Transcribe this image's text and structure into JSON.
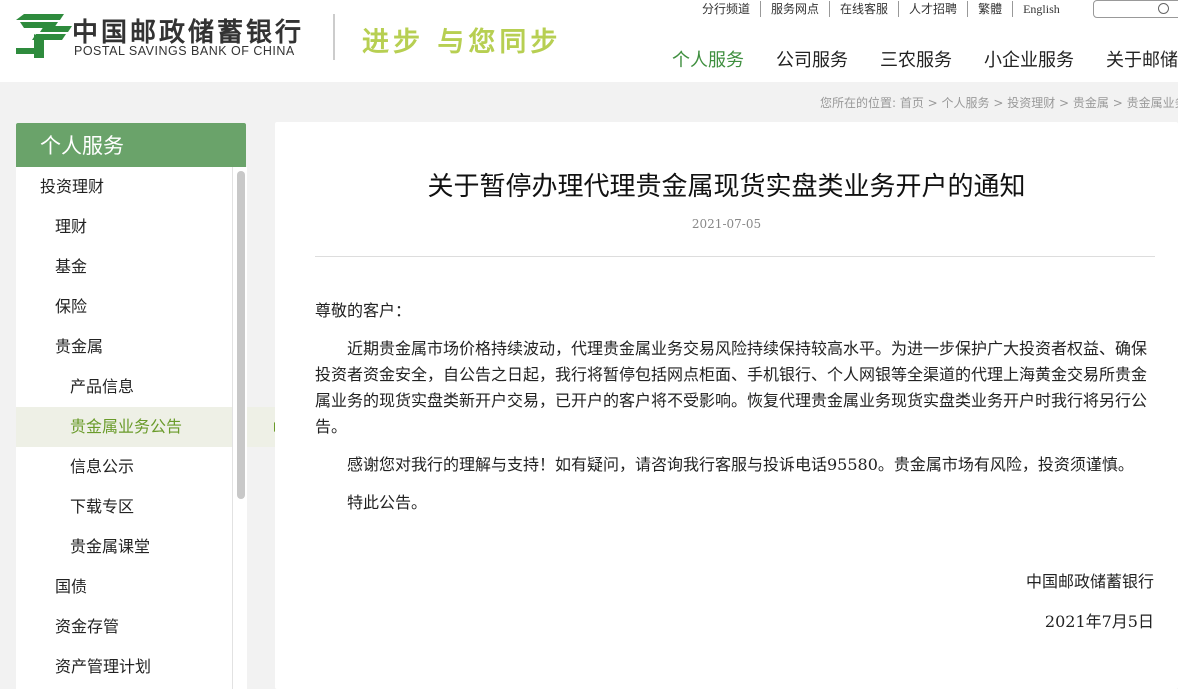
{
  "brand": {
    "name_cn": "中国邮政储蓄银行",
    "name_en": "POSTAL SAVINGS BANK OF CHINA",
    "slogan": "进步 与您同步",
    "green": "#3f8f3f",
    "lime": "#b7cf52"
  },
  "top_links": [
    "分行频道",
    "服务网点",
    "在线客服",
    "人才招聘",
    "繁體",
    "English"
  ],
  "main_nav": [
    "个人服务",
    "公司服务",
    "三农服务",
    "小企业服务",
    "关于邮储"
  ],
  "breadcrumb": "您所在的位置: 首页 > 个人服务 > 投资理财 > 贵金属 > 贵金属业务公告",
  "sidebar": {
    "title": "个人服务",
    "items": [
      {
        "label": "投资理财",
        "level": 1
      },
      {
        "label": "理财",
        "level": 2
      },
      {
        "label": "基金",
        "level": 2
      },
      {
        "label": "保险",
        "level": 2
      },
      {
        "label": "贵金属",
        "level": 2
      },
      {
        "label": "产品信息",
        "level": 3
      },
      {
        "label": "贵金属业务公告",
        "level": 3,
        "active": true
      },
      {
        "label": "信息公示",
        "level": 3
      },
      {
        "label": "下载专区",
        "level": 3
      },
      {
        "label": "贵金属课堂",
        "level": 3
      },
      {
        "label": "国债",
        "level": 2
      },
      {
        "label": "资金存管",
        "level": 2
      },
      {
        "label": "资产管理计划",
        "level": 2
      }
    ]
  },
  "article": {
    "title": "关于暂停办理代理贵金属现货实盘类业务开户的通知",
    "date": "2021-07-05",
    "greeting": "尊敬的客户：",
    "para1": "近期贵金属市场价格持续波动，代理贵金属业务交易风险持续保持较高水平。为进一步保护广大投资者权益、确保投资者资金安全，自公告之日起，我行将暂停包括网点柜面、手机银行、个人网银等全渠道的代理上海黄金交易所贵金属业务的现货实盘类新开户交易，已开户的客户将不受影响。恢复代理贵金属业务现货实盘类业务开户时我行将另行公告。",
    "para2": "感谢您对我行的理解与支持！如有疑问，请咨询我行客服与投诉电话95580。贵金属市场有风险，投资须谨慎。",
    "para3": "特此公告。",
    "signer": "中国邮政储蓄银行",
    "sign_date": "2021年7月5日"
  }
}
